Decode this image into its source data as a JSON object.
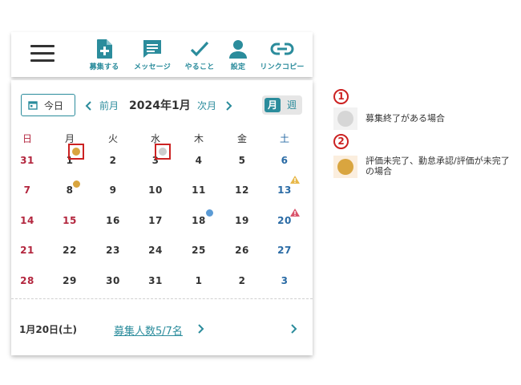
{
  "toolbar": {
    "items": [
      {
        "label": "募集する",
        "icon": "document-plus-icon"
      },
      {
        "label": "メッセージ",
        "icon": "message-icon"
      },
      {
        "label": "やること",
        "icon": "check-icon"
      },
      {
        "label": "設定",
        "icon": "person-icon"
      },
      {
        "label": "リンクコピー",
        "icon": "link-icon"
      }
    ],
    "accent": "#2b8c9c"
  },
  "calendar": {
    "today_label": "今日",
    "prev_label": "前月",
    "next_label": "次月",
    "title": "2024年1月",
    "view_month": "月",
    "view_week": "週",
    "weekdays": [
      "日",
      "月",
      "火",
      "水",
      "木",
      "金",
      "土"
    ],
    "weeks": [
      [
        "31",
        "1",
        "2",
        "3",
        "4",
        "5",
        "6"
      ],
      [
        "7",
        "8",
        "9",
        "10",
        "11",
        "12",
        "13"
      ],
      [
        "14",
        "15",
        "16",
        "17",
        "18",
        "19",
        "20"
      ],
      [
        "21",
        "22",
        "23",
        "24",
        "25",
        "26",
        "27"
      ],
      [
        "28",
        "29",
        "30",
        "31",
        "1",
        "2",
        "3"
      ]
    ],
    "colors": {
      "sunday_holiday": "#b3263e",
      "saturday": "#2a6ba5",
      "dot_orange": "#d9a53f",
      "dot_gray": "#cccccc",
      "dot_blue": "#5b9bd5",
      "warn_yellow": "#e8b84a",
      "warn_red": "#d9536b"
    }
  },
  "footer": {
    "selected_date": "1月20日(土)",
    "recruit_link": "募集人数5/7名"
  },
  "legend": [
    {
      "number": "1",
      "text": "募集終了がある場合"
    },
    {
      "number": "2",
      "text": "評価未完了、勤怠承認/評価が未完了の場合"
    }
  ]
}
